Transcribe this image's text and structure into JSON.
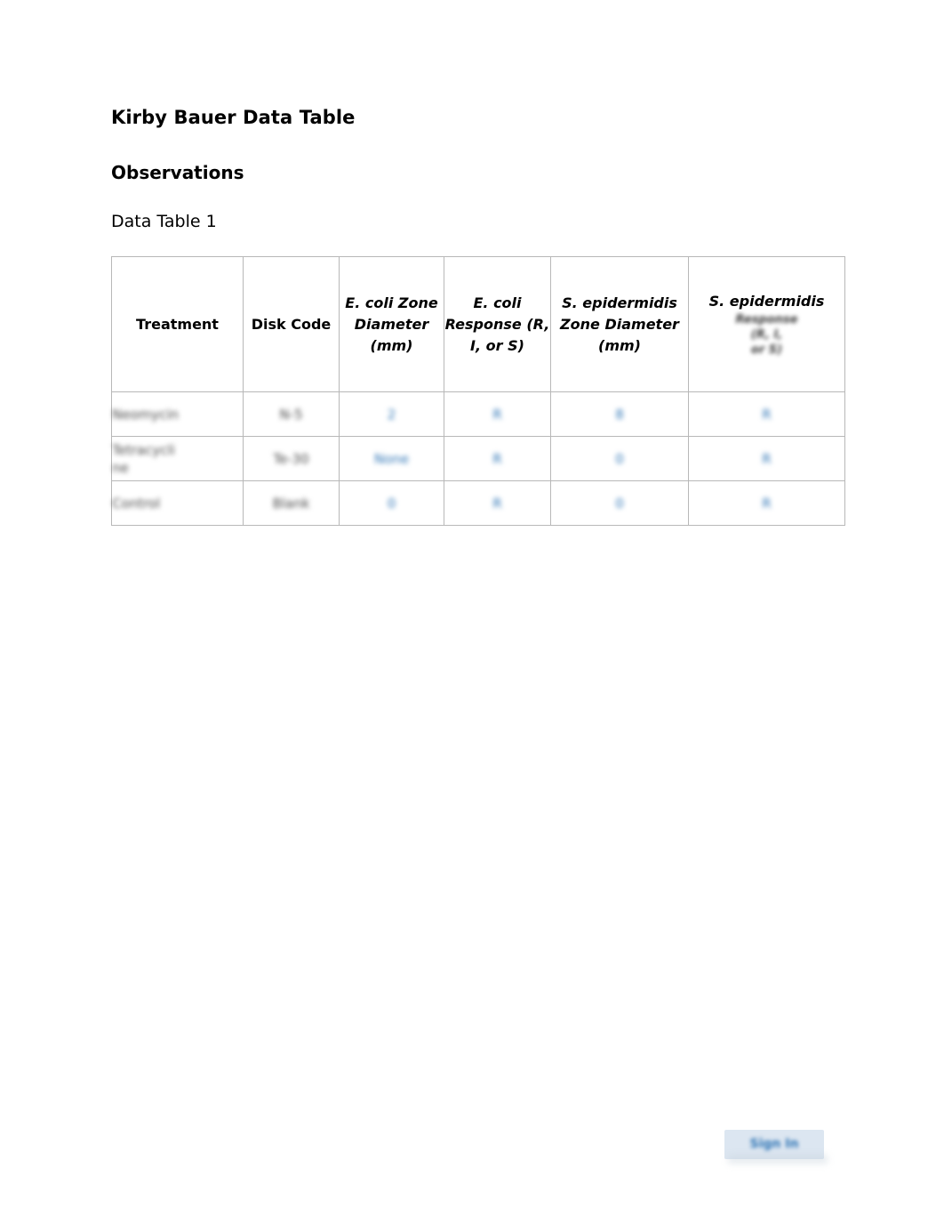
{
  "document": {
    "title": "Kirby Bauer Data Table",
    "section_heading": "Observations",
    "table_label": "Data Table 1"
  },
  "table": {
    "headers": [
      "Treatment",
      "Disk Code",
      "E. coli Zone Diameter (mm)",
      "E. coli Response (R, I, or S)",
      "S. epidermidis Zone Diameter (mm)",
      "S. epidermidis"
    ],
    "header_6_blurred": "Response\n(R, I,\nor S)",
    "rows": [
      {
        "treatment": "Neomycin",
        "disk_code": "N-5",
        "ecoli_zone": "2",
        "ecoli_response": "R",
        "sepi_zone": "8",
        "sepi_response": "R"
      },
      {
        "treatment": "Tetracycli\nne",
        "disk_code": "Te-30",
        "ecoli_zone": "None",
        "ecoli_response": "R",
        "sepi_zone": "0",
        "sepi_response": "R"
      },
      {
        "treatment": "Control",
        "disk_code": "Blank",
        "ecoli_zone": "0",
        "ecoli_response": "R",
        "sepi_zone": "0",
        "sepi_response": "R"
      }
    ]
  },
  "footer": {
    "badge_text": "Sign In"
  }
}
